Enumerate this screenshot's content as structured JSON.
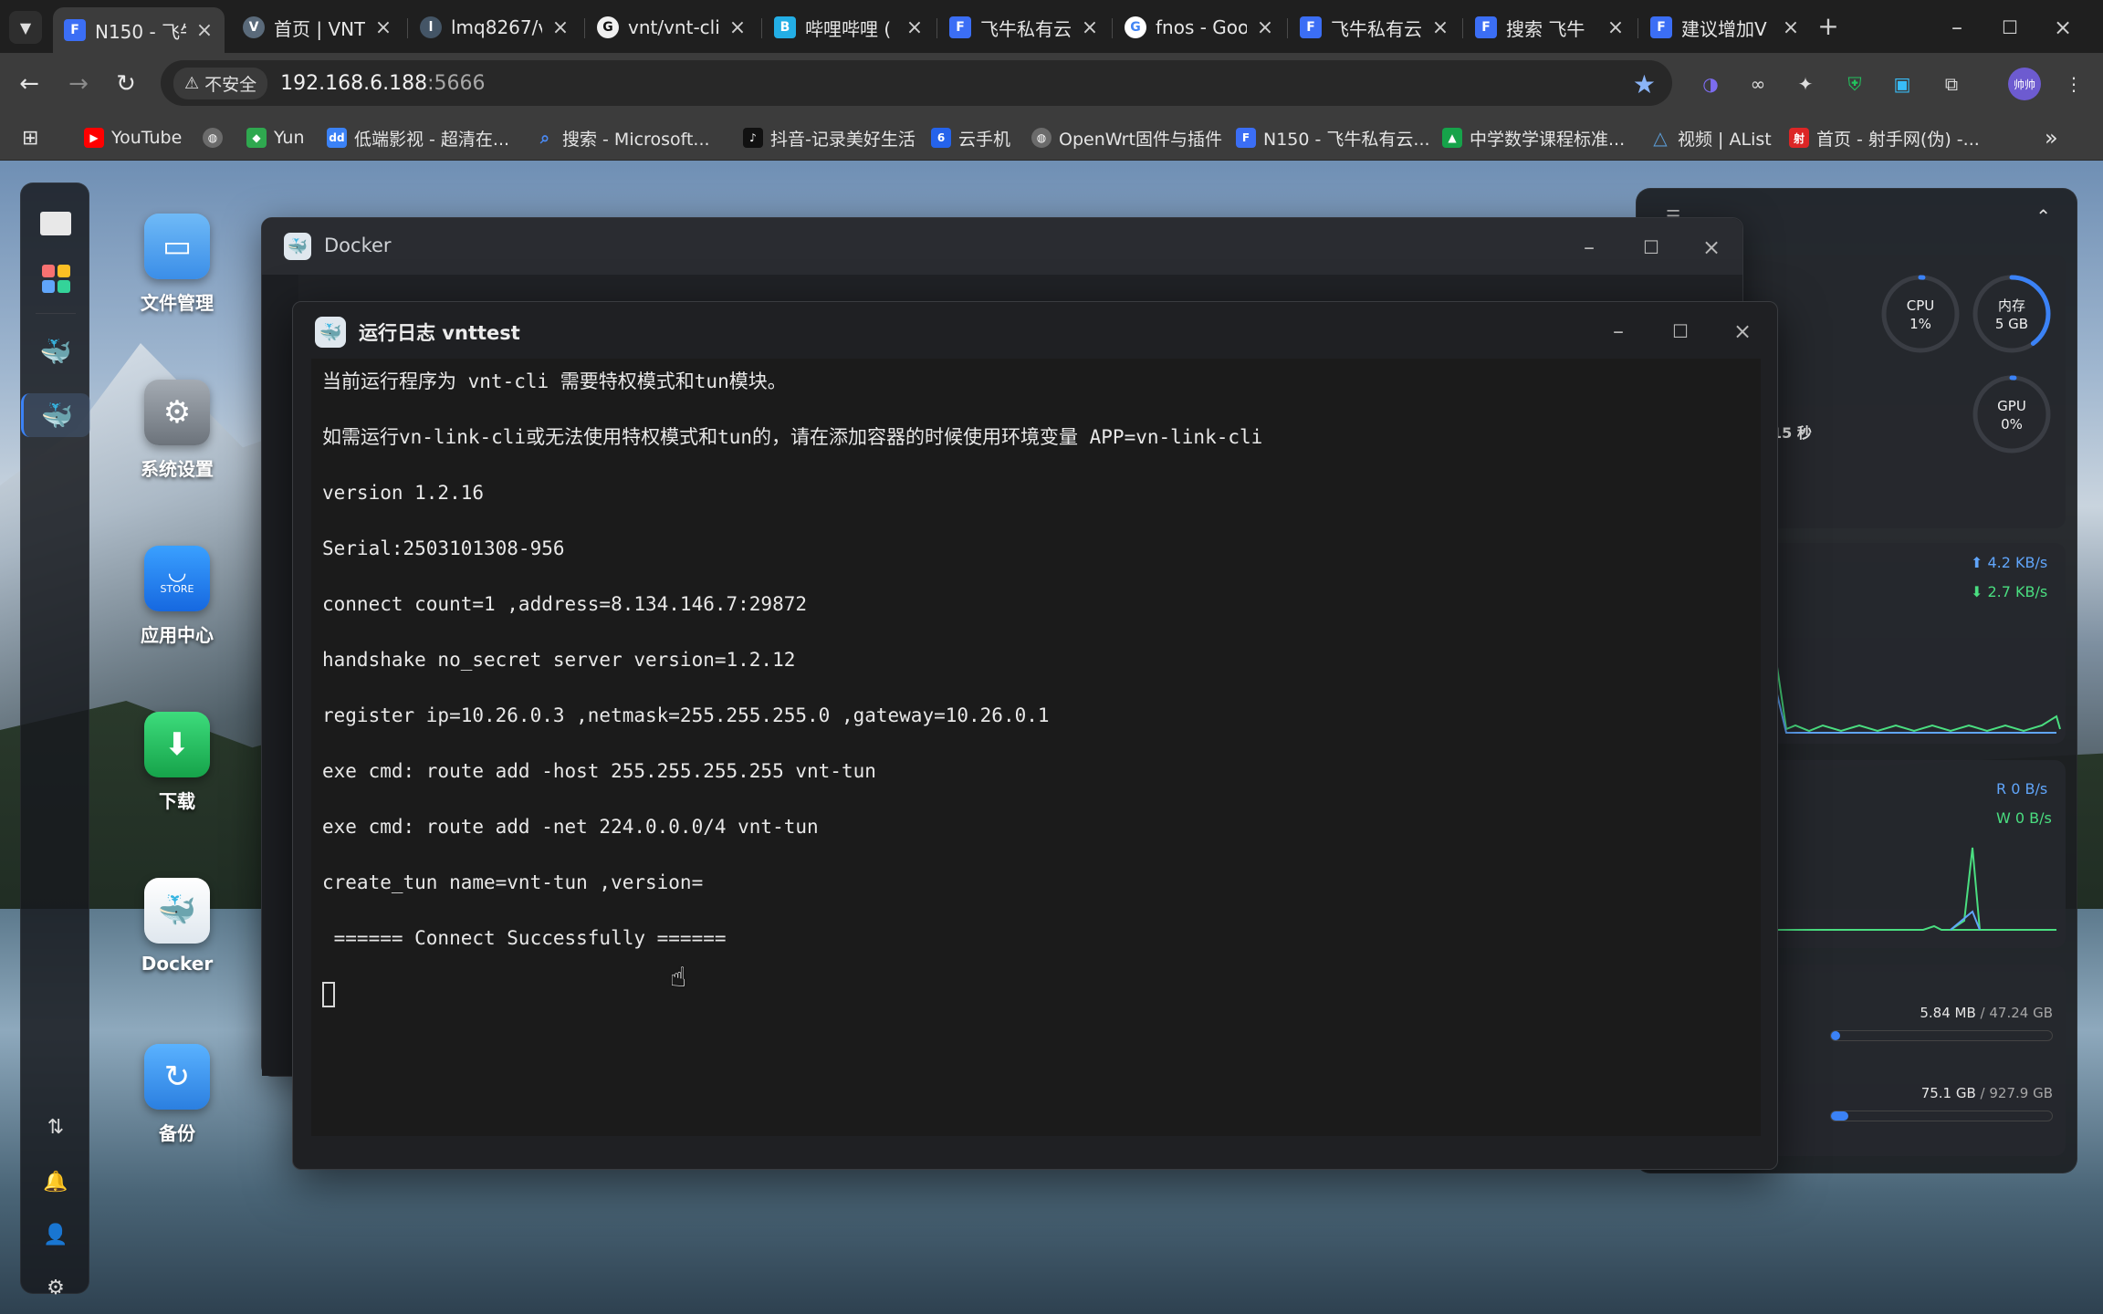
{
  "browser": {
    "tabs": [
      {
        "title": "N150 - 飞牛",
        "icon": "fnos-tab-icon",
        "color": "#3b6ef5",
        "active": true
      },
      {
        "title": "首页 | VNT",
        "icon": "vnt-tab-icon",
        "color": "#5a6a7a",
        "active": false
      },
      {
        "title": "lmq8267/v",
        "icon": "avatar-tab-icon",
        "color": "#445566",
        "active": false
      },
      {
        "title": "vnt/vnt-cli",
        "icon": "github-icon",
        "color": "#222222",
        "active": false
      },
      {
        "title": "哔哩哔哩 (",
        "icon": "bilibili-icon",
        "color": "#23aee5",
        "active": false
      },
      {
        "title": "飞牛私有云",
        "icon": "fnos-tab-icon",
        "color": "#3b6ef5",
        "active": false
      },
      {
        "title": "fnos - Goo",
        "icon": "google-icon",
        "color": "#ffffff",
        "active": false
      },
      {
        "title": "飞牛私有云",
        "icon": "fnos-tab-icon",
        "color": "#3b6ef5",
        "active": false
      },
      {
        "title": "搜索 飞牛",
        "icon": "fnos-tab-icon",
        "color": "#3b6ef5",
        "active": false
      },
      {
        "title": "建议增加V",
        "icon": "fnos-tab-icon",
        "color": "#3b6ef5",
        "active": false
      }
    ],
    "security_label": "不安全",
    "url_host": "192.168.6.188",
    "url_port": ":5666",
    "bookmarks": [
      {
        "label": "YouTube",
        "icon": "youtube-icon",
        "color": "#ff0000"
      },
      {
        "label": "",
        "icon": "globe-icon",
        "color": "#6b6b6b"
      },
      {
        "label": "Yun",
        "icon": "yun-icon",
        "color": "#2fa84f"
      },
      {
        "label": "低端影视 - 超清在...",
        "icon": "ddys-icon",
        "color": "#3b82f6"
      },
      {
        "label": "搜索 - Microsoft...",
        "icon": "search-icon",
        "color": "#4a8af4"
      },
      {
        "label": "抖音-记录美好生活",
        "icon": "douyin-icon",
        "color": "#111111"
      },
      {
        "label": "云手机",
        "icon": "cloud-phone-icon",
        "color": "#2563eb"
      },
      {
        "label": "OpenWrt固件与插件",
        "icon": "globe-icon",
        "color": "#6b6b6b"
      },
      {
        "label": "N150 - 飞牛私有云...",
        "icon": "fnos-bookmark-icon",
        "color": "#3b6ef5"
      },
      {
        "label": "中学数学课程标准...",
        "icon": "math-icon",
        "color": "#16a34a"
      },
      {
        "label": "视频 | AList",
        "icon": "alist-icon",
        "color": "#5b9bd5"
      },
      {
        "label": "首页 - 射手网(伪) -...",
        "icon": "shooter-icon",
        "color": "#dc2626"
      }
    ]
  },
  "desktop": {
    "icons": [
      {
        "label": "文件管理",
        "icon": "folder-icon",
        "color": "#4aa3f0"
      },
      {
        "label": "系统设置",
        "icon": "gear-icon",
        "color": "#8a9098"
      },
      {
        "label": "应用中心",
        "icon": "store-icon",
        "color": "#1e90ff",
        "sub": "STORE"
      },
      {
        "label": "下载",
        "icon": "download-icon",
        "color": "#22c55e"
      },
      {
        "label": "Docker",
        "icon": "docker-icon",
        "color": "#e8eef2"
      },
      {
        "label": "备份",
        "icon": "backup-icon",
        "color": "#3b9cf0"
      }
    ]
  },
  "monitor": {
    "cpu_label": "CPU",
    "cpu_value": "1%",
    "cpu_level": 0.01,
    "mem_label": "内存",
    "mem_value": "5 GB",
    "mem_level": 0.4,
    "gpu_label": "GPU",
    "gpu_value": "0%",
    "gpu_level": 0,
    "uptime_fragment": "15 秒",
    "net_up": "4.2 KB/s",
    "net_down": "2.7 KB/s",
    "disk_read": "R  0 B/s",
    "disk_write": "W  0 B/s",
    "storage1_used": "5.84 MB",
    "storage1_total": " / 47.24 GB",
    "storage1_level": 0.0001,
    "storage2_used": "75.1 GB",
    "storage2_total": " / 927.9 GB",
    "storage2_level": 0.08,
    "colors": {
      "up": "#60a5fa",
      "down": "#4ade80"
    }
  },
  "docker_window": {
    "title": "Docker"
  },
  "log_window": {
    "title": "运行日志 vnttest",
    "lines": [
      "当前运行程序为 vnt-cli 需要特权模式和tun模块。",
      "如需运行vn-link-cli或无法使用特权模式和tun的，请在添加容器的时候使用环境变量 APP=vn-link-cli",
      "version 1.2.16",
      "Serial:2503101308-956",
      "connect count=1 ,address=8.134.146.7:29872",
      "handshake no_secret server version=1.2.12",
      "register ip=10.26.0.3 ,netmask=255.255.255.0 ,gateway=10.26.0.1",
      "exe cmd: route add -host 255.255.255.255 vnt-tun",
      "exe cmd: route add -net 224.0.0.0/4 vnt-tun",
      "create_tun name=vnt-tun ,version=",
      " ====== Connect Successfully ======"
    ]
  }
}
